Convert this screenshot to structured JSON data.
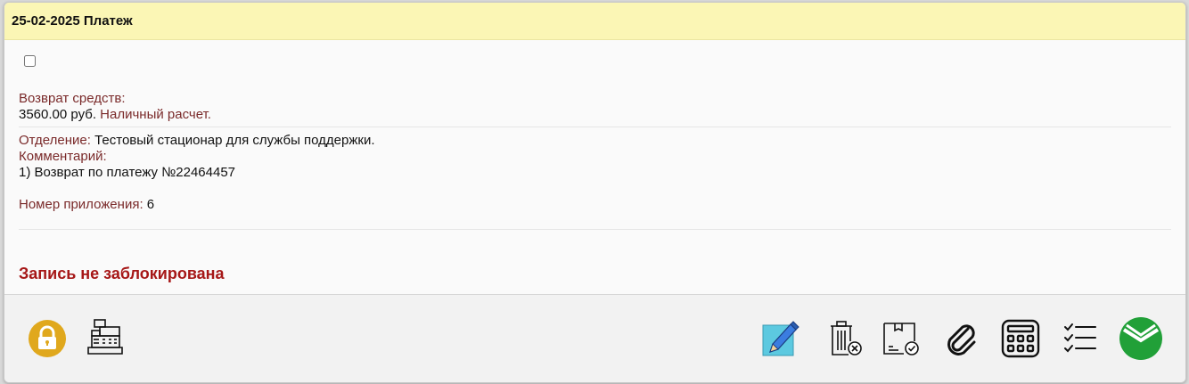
{
  "header": {
    "title": "25-02-2025 Платеж"
  },
  "record": {
    "operation_label": "Возврат средств:",
    "amount": "3560.00 руб.",
    "payment_type": "Наличный расчет.",
    "department_label": "Отделение:",
    "department_value": "Тестовый стационар для службы поддержки.",
    "comment_label": "Комментарий:",
    "comment_value": "1) Возврат по платежу №22464457",
    "attachment_label": "Номер приложения:",
    "attachment_value": "6",
    "lock_status": "Запись не заблокирована"
  },
  "colors": {
    "header_bg": "#fbf6b5",
    "label": "#7a2a2a",
    "lock_status": "#a61717",
    "lock_icon": "#e0a81d",
    "edit_icon_bg": "#5cc9e0",
    "sber_green": "#21a038"
  },
  "toolbar": {
    "left_icons": [
      "lock-icon",
      "cash-register-icon"
    ],
    "right_icons": [
      "edit-icon",
      "delete-icon",
      "package-check-icon",
      "paperclip-icon",
      "calculator-icon",
      "checklist-icon",
      "sberbank-icon"
    ]
  }
}
